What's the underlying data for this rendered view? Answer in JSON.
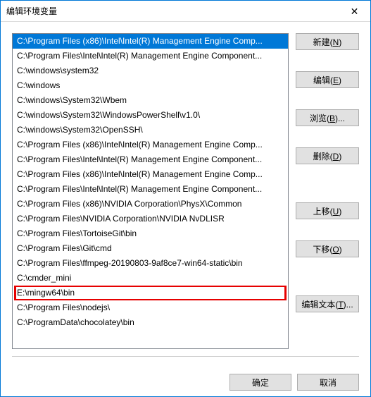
{
  "title": "编辑环境变量",
  "list": {
    "items": [
      {
        "path": "C:\\Program Files (x86)\\Intel\\Intel(R) Management Engine Comp...",
        "selected": true
      },
      {
        "path": "C:\\Program Files\\Intel\\Intel(R) Management Engine Component..."
      },
      {
        "path": "C:\\windows\\system32"
      },
      {
        "path": "C:\\windows"
      },
      {
        "path": "C:\\windows\\System32\\Wbem"
      },
      {
        "path": "C:\\windows\\System32\\WindowsPowerShell\\v1.0\\"
      },
      {
        "path": "C:\\windows\\System32\\OpenSSH\\"
      },
      {
        "path": "C:\\Program Files (x86)\\Intel\\Intel(R) Management Engine Comp..."
      },
      {
        "path": "C:\\Program Files\\Intel\\Intel(R) Management Engine Component..."
      },
      {
        "path": "C:\\Program Files (x86)\\Intel\\Intel(R) Management Engine Comp..."
      },
      {
        "path": "C:\\Program Files\\Intel\\Intel(R) Management Engine Component..."
      },
      {
        "path": "C:\\Program Files (x86)\\NVIDIA Corporation\\PhysX\\Common"
      },
      {
        "path": "C:\\Program Files\\NVIDIA Corporation\\NVIDIA NvDLISR"
      },
      {
        "path": "C:\\Program Files\\TortoiseGit\\bin"
      },
      {
        "path": "C:\\Program Files\\Git\\cmd"
      },
      {
        "path": "C:\\Program Files\\ffmpeg-20190803-9af8ce7-win64-static\\bin"
      },
      {
        "path": "C:\\cmder_mini"
      },
      {
        "path": "E:\\mingw64\\bin",
        "highlighted": true
      },
      {
        "path": "C:\\Program Files\\nodejs\\"
      },
      {
        "path": "C:\\ProgramData\\chocolatey\\bin"
      }
    ]
  },
  "buttons": {
    "new": {
      "label": "新建(",
      "shortcut": "N",
      "suffix": ")"
    },
    "edit": {
      "label": "编辑(",
      "shortcut": "E",
      "suffix": ")"
    },
    "browse": {
      "label": "浏览(",
      "shortcut": "B",
      "suffix": ")..."
    },
    "delete": {
      "label": "删除(",
      "shortcut": "D",
      "suffix": ")"
    },
    "moveup": {
      "label": "上移(",
      "shortcut": "U",
      "suffix": ")"
    },
    "movedown": {
      "label": "下移(",
      "shortcut": "O",
      "suffix": ")"
    },
    "edittext": {
      "label": "编辑文本(",
      "shortcut": "T",
      "suffix": ")..."
    }
  },
  "footer": {
    "ok": "确定",
    "cancel": "取消"
  }
}
